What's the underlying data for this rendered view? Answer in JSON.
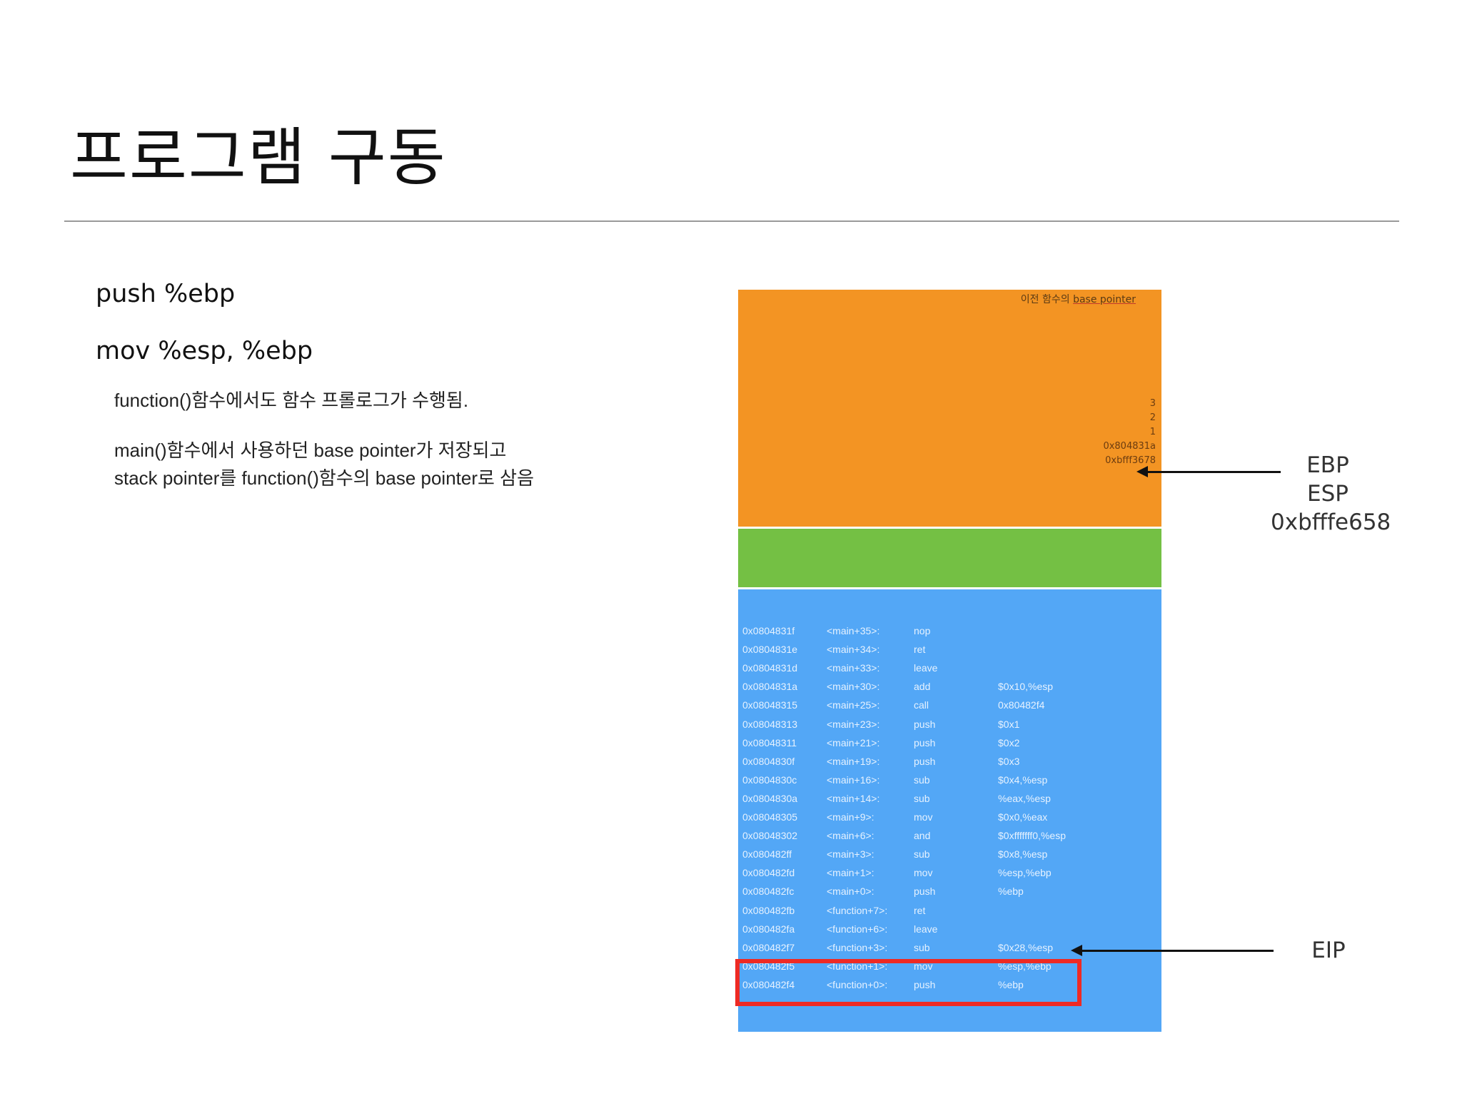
{
  "slide": {
    "title": "프로그램 구동",
    "code": [
      "push %ebp",
      "mov %esp, %ebp"
    ],
    "desc1": "function()함수에서도 함수 프롤로그가 수행됨.",
    "desc2a": "main()함수에서 사용하던 base pointer가 저장되고",
    "desc2b": "stack pointer를 function()함수의 base pointer로 삼음"
  },
  "stack": {
    "caption_prefix": "이전 함수의 ",
    "caption_underlined": "base pointer",
    "values": [
      "3",
      "2",
      "1",
      "0x804831a",
      "0xbfff3678"
    ],
    "colors": {
      "frame": "#f39423",
      "green": "#74c044",
      "code": "#53a7f6",
      "highlight": "#ee2a24"
    }
  },
  "disasm": [
    {
      "addr": "0x0804831f",
      "sym": "<main+35>:",
      "op": "nop",
      "arg": ""
    },
    {
      "addr": "0x0804831e",
      "sym": "<main+34>:",
      "op": "ret",
      "arg": ""
    },
    {
      "addr": "0x0804831d",
      "sym": "<main+33>:",
      "op": "leave",
      "arg": ""
    },
    {
      "addr": "0x0804831a",
      "sym": "<main+30>:",
      "op": "add",
      "arg": "$0x10,%esp"
    },
    {
      "addr": "0x08048315",
      "sym": "<main+25>:",
      "op": "call",
      "arg": "0x80482f4"
    },
    {
      "addr": "0x08048313",
      "sym": "<main+23>:",
      "op": "push",
      "arg": "$0x1"
    },
    {
      "addr": "0x08048311",
      "sym": "<main+21>:",
      "op": "push",
      "arg": "$0x2"
    },
    {
      "addr": "0x0804830f",
      "sym": "<main+19>:",
      "op": "push",
      "arg": "$0x3"
    },
    {
      "addr": "0x0804830c",
      "sym": "<main+16>:",
      "op": "sub",
      "arg": "$0x4,%esp"
    },
    {
      "addr": "0x0804830a",
      "sym": "<main+14>:",
      "op": "sub",
      "arg": "%eax,%esp"
    },
    {
      "addr": "0x08048305",
      "sym": "<main+9>:",
      "op": "mov",
      "arg": "$0x0,%eax"
    },
    {
      "addr": "0x08048302",
      "sym": "<main+6>:",
      "op": "and",
      "arg": "$0xfffffff0,%esp"
    },
    {
      "addr": "0x080482ff",
      "sym": "<main+3>:",
      "op": "sub",
      "arg": "$0x8,%esp"
    },
    {
      "addr": "0x080482fd",
      "sym": "<main+1>:",
      "op": "mov",
      "arg": "%esp,%ebp"
    },
    {
      "addr": "0x080482fc",
      "sym": "<main+0>:",
      "op": "push",
      "arg": "%ebp"
    },
    {
      "addr": "0x080482fb",
      "sym": "<function+7>:",
      "op": "ret",
      "arg": ""
    },
    {
      "addr": "0x080482fa",
      "sym": "<function+6>:",
      "op": "leave",
      "arg": ""
    },
    {
      "addr": "0x080482f7",
      "sym": "<function+3>:",
      "op": "sub",
      "arg": "$0x28,%esp"
    },
    {
      "addr": "0x080482f5",
      "sym": "<function+1>:",
      "op": "mov",
      "arg": "%esp,%ebp"
    },
    {
      "addr": "0x080482f4",
      "sym": "<function+0>:",
      "op": "push",
      "arg": "%ebp"
    }
  ],
  "labels": {
    "ebp": "EBP",
    "esp": "ESP",
    "esp_value": "0xbfffe658",
    "eip": "EIP"
  }
}
